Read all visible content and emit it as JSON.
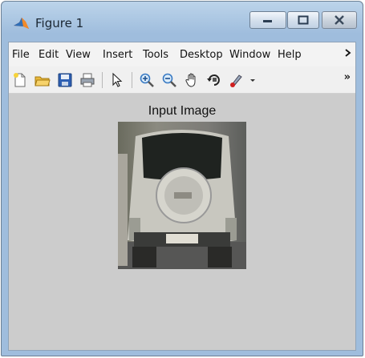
{
  "window": {
    "title": "Figure 1"
  },
  "menubar": {
    "items": [
      "File",
      "Edit",
      "View",
      "Insert",
      "Tools",
      "Desktop",
      "Window",
      "Help"
    ],
    "overflow_icon": "chevron-right-icon"
  },
  "toolbar": {
    "icons": [
      "new-figure-icon",
      "open-file-icon",
      "save-icon",
      "print-icon",
      "pointer-icon",
      "zoom-in-icon",
      "zoom-out-icon",
      "pan-icon",
      "rotate-3d-icon",
      "data-cursor-icon"
    ],
    "overflow_label": "»"
  },
  "axes": {
    "title": "Input Image"
  },
  "colors": {
    "titlebar": "#9fbddd",
    "figure_bg": "#cccccc",
    "close_hover": "#c9d2dc"
  }
}
